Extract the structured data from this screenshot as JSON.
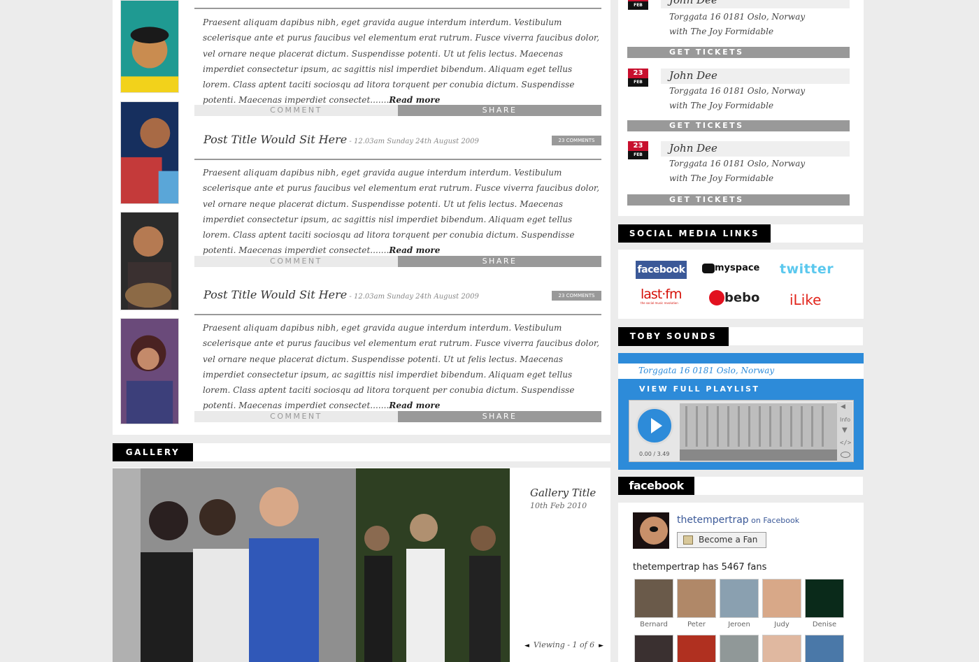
{
  "posts": [
    {
      "body": "Praesent aliquam dapibus nibh, eget gravida augue interdum interdum. Vestibulum scelerisque ante et purus faucibus vel elementum erat rutrum. Fusce viverra faucibus dolor, vel ornare neque placerat dictum. Suspendisse potenti. Ut ut felis lectus. Maecenas imperdiet consectetur ipsum, ac sagittis nisl imperdiet bibendum. Aliquam eget tellus lorem. Class aptent taciti sociosqu ad litora torquent per conubia dictum. Suspendisse potenti. Maecenas imperdiet consectet.......",
      "read_more": "Read more",
      "comment_label": "COMMENT",
      "share_label": "SHARE"
    },
    {
      "title": "Post Title Would Sit Here",
      "meta": " - 12.03am Sunday 24th August 2009",
      "comments_badge": "23 COMMENTS",
      "body": "Praesent aliquam dapibus nibh, eget gravida augue interdum interdum. Vestibulum scelerisque ante et purus faucibus vel elementum erat rutrum. Fusce viverra faucibus dolor, vel ornare neque placerat dictum. Suspendisse potenti. Ut ut felis lectus. Maecenas imperdiet consectetur ipsum, ac sagittis nisl imperdiet bibendum. Aliquam eget tellus lorem. Class aptent taciti sociosqu ad litora torquent per conubia dictum. Suspendisse potenti. Maecenas imperdiet consectet.......",
      "read_more": "Read more",
      "comment_label": "COMMENT",
      "share_label": "SHARE"
    },
    {
      "title": "Post Title Would Sit Here",
      "meta": " - 12.03am Sunday 24th August 2009",
      "comments_badge": "23 COMMENTS",
      "body": "Praesent aliquam dapibus nibh, eget gravida augue interdum interdum. Vestibulum scelerisque ante et purus faucibus vel elementum erat rutrum. Fusce viverra faucibus dolor, vel ornare neque placerat dictum. Suspendisse potenti. Ut ut felis lectus. Maecenas imperdiet consectetur ipsum, ac sagittis nisl imperdiet bibendum. Aliquam eget tellus lorem. Class aptent taciti sociosqu ad litora torquent per conubia dictum. Suspendisse potenti. Maecenas imperdiet consectet.......",
      "read_more": "Read more",
      "comment_label": "COMMENT",
      "share_label": "SHARE"
    }
  ],
  "gallery": {
    "label": "GALLERY",
    "title": "Gallery Title",
    "date": "10th Feb 2010",
    "viewing": "Viewing - 1 of 6",
    "prev_icon": "◄",
    "next_icon": "►"
  },
  "events": [
    {
      "day": "",
      "month": "FEB",
      "name": "John Dee",
      "address_line1": "Torggata 16 0181 Oslo, Norway",
      "address_line2": "with The Joy Formidable",
      "ticket_label": "GET TICKETS"
    },
    {
      "day": "23",
      "month": "FEB",
      "name": "John Dee",
      "address_line1": "Torggata 16 0181 Oslo, Norway",
      "address_line2": "with The Joy Formidable",
      "ticket_label": "GET TICKETS"
    },
    {
      "day": "23",
      "month": "FEB",
      "name": "John Dee",
      "address_line1": "Torggata 16 0181 Oslo, Norway",
      "address_line2": "with The Joy Formidable",
      "ticket_label": "GET TICKETS"
    }
  ],
  "social": {
    "label": "SOCIAL MEDIA LINKS",
    "links": [
      "facebook",
      "myspace",
      "twitter",
      "last·fm",
      "bebo",
      "iLike"
    ],
    "lastfm_tagline": "the social music revolution"
  },
  "sounds": {
    "label": "TOBY SOUNDS",
    "address": "Torggata 16 0181 Oslo, Norway",
    "playlist_label": "VIEW FULL PLAYLIST",
    "time": "0.00 / 3.49",
    "info_label": "Info"
  },
  "facebook": {
    "label": "facebook",
    "page_name": "thetempertrap",
    "on_facebook": " on Facebook",
    "become_fan": "Become a Fan",
    "fan_count": "thetempertrap has 5467 fans",
    "fans": [
      "Bernard",
      "Peter",
      "Jeroen",
      "Judy",
      "Denise"
    ]
  },
  "colors": {
    "accent_blue": "#2d8bd9",
    "date_red": "#c8102e",
    "button_grey": "#999999",
    "facebook_blue": "#3b5998"
  }
}
